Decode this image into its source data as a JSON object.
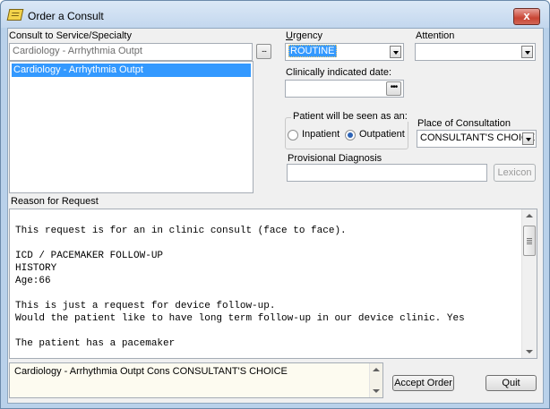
{
  "window": {
    "title": "Order a Consult",
    "close_label": "x"
  },
  "service": {
    "label": "Consult to Service/Specialty",
    "value": "Cardiology - Arrhythmia Outpt",
    "browse_label": "...",
    "list_items": [
      "Cardiology - Arrhythmia Outpt"
    ]
  },
  "urgency": {
    "label": "Urgency",
    "value": "ROUTINE"
  },
  "attention": {
    "label": "Attention",
    "value": ""
  },
  "clinically_indicated_date": {
    "label": "Clinically indicated date:",
    "value": "",
    "button_label": "•••"
  },
  "patient_seen": {
    "label": "Patient will be seen as an:",
    "options": [
      {
        "label": "Inpatient",
        "checked": false
      },
      {
        "label": "Outpatient",
        "checked": true
      }
    ]
  },
  "place_of_consultation": {
    "label": "Place of Consultation",
    "value": "CONSULTANT'S CHOICE"
  },
  "provisional_diagnosis": {
    "label": "Provisional Diagnosis",
    "value": "",
    "lexicon_label": "Lexicon"
  },
  "reason_for_request": {
    "label": "Reason for Request",
    "lines": [
      "",
      "This request is for an in clinic consult (face to face).",
      "",
      "ICD / PACEMAKER FOLLOW-UP",
      "HISTORY",
      "Age:66",
      "",
      "This is just a request for device follow-up.",
      "Would the patient like to have long term follow-up in our device clinic. Yes",
      "",
      "The patient has a pacemaker"
    ]
  },
  "order_summary": "Cardiology - Arrhythmia Outpt Cons CONSULTANT'S CHOICE",
  "buttons": {
    "accept_order": "Accept Order",
    "quit": "Quit"
  }
}
